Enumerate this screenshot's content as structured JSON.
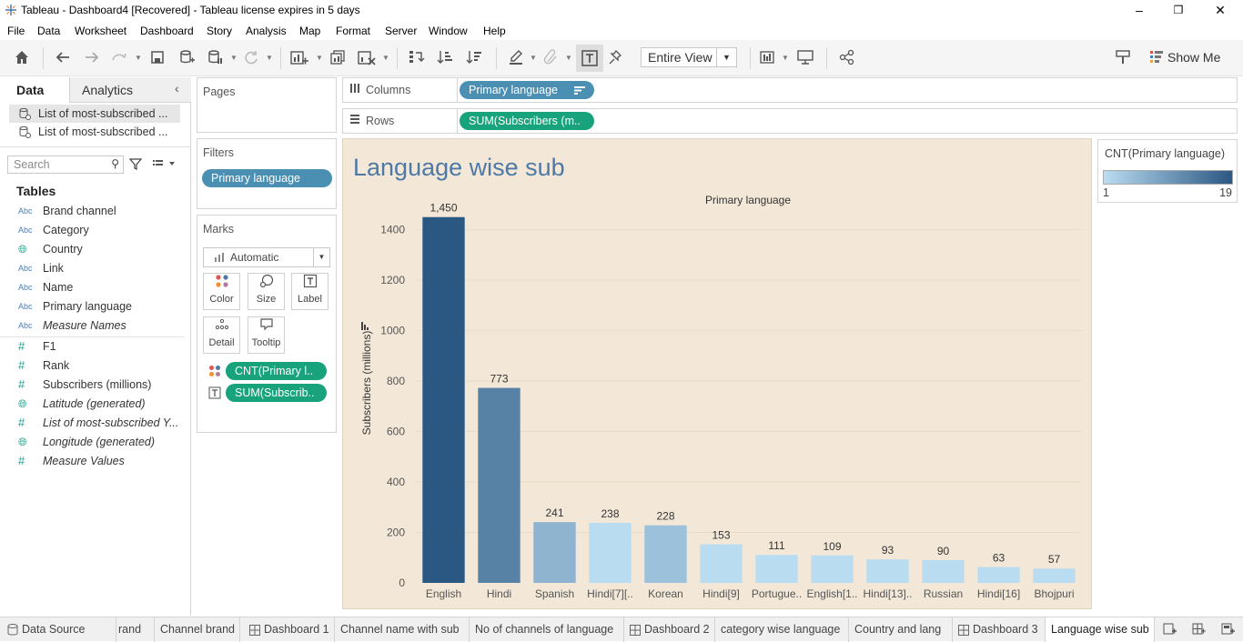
{
  "window": {
    "title": "Tableau - Dashboard4 [Recovered] - Tableau license expires in 5 days"
  },
  "menu": [
    "File",
    "Data",
    "Worksheet",
    "Dashboard",
    "Story",
    "Analysis",
    "Map",
    "Format",
    "Server",
    "Window",
    "Help"
  ],
  "toolbar": {
    "fit": "Entire View",
    "show_me": "Show Me"
  },
  "left_panel": {
    "tab_data": "Data",
    "tab_analytics": "Analytics",
    "datasources": [
      "List of most-subscribed ...",
      "List of most-subscribed ..."
    ],
    "search_placeholder": "Search",
    "tables_heading": "Tables",
    "fields": [
      {
        "type": "Abc",
        "name": "Brand channel"
      },
      {
        "type": "Abc",
        "name": "Category"
      },
      {
        "type": "geo",
        "name": "Country"
      },
      {
        "type": "Abc",
        "name": "Link"
      },
      {
        "type": "Abc",
        "name": "Name"
      },
      {
        "type": "Abc",
        "name": "Primary language"
      },
      {
        "type": "Abc",
        "name": "Measure Names"
      },
      {
        "type": "#",
        "name": "F1"
      },
      {
        "type": "#",
        "name": "Rank"
      },
      {
        "type": "#",
        "name": "Subscribers (millions)"
      },
      {
        "type": "geo",
        "name": "Latitude (generated)"
      },
      {
        "type": "#",
        "name": "List of most-subscribed Y..."
      },
      {
        "type": "geo",
        "name": "Longitude (generated)"
      },
      {
        "type": "#",
        "name": "Measure Values"
      }
    ]
  },
  "cards": {
    "pages": "Pages",
    "filters": "Filters",
    "filter_pill": "Primary language",
    "marks": "Marks",
    "mark_type": "Automatic",
    "mark_buttons": [
      "Color",
      "Size",
      "Label",
      "Detail",
      "Tooltip"
    ],
    "mark_pills": [
      "CNT(Primary l..",
      "SUM(Subscrib.."
    ]
  },
  "shelves": {
    "columns_label": "Columns",
    "columns_pill": "Primary language",
    "rows_label": "Rows",
    "rows_pill": "SUM(Subscribers (m.."
  },
  "legend": {
    "title": "CNT(Primary language)",
    "min": "1",
    "max": "19"
  },
  "viz": {
    "title": "Language wise sub"
  },
  "chart_data": {
    "type": "bar",
    "title": "Language wise sub",
    "xlabel": "Primary language",
    "ylabel": "Subscribers (millions)",
    "categories": [
      "English",
      "Hindi",
      "Spanish",
      "Hindi[7][..",
      "Korean",
      "Hindi[9]",
      "Portugue..",
      "English[1..",
      "Hindi[13]..",
      "Russian",
      "Hindi[16]",
      "Bhojpuri"
    ],
    "values": [
      1450,
      773,
      241,
      238,
      228,
      153,
      111,
      109,
      93,
      90,
      63,
      57
    ],
    "value_labels": [
      "1,450",
      "773",
      "241",
      "238",
      "228",
      "153",
      "111",
      "109",
      "93",
      "90",
      "63",
      "57"
    ],
    "color_values": [
      19,
      10,
      3,
      1,
      2,
      1,
      1,
      1,
      1,
      1,
      1,
      1
    ],
    "yticks": [
      0,
      200,
      400,
      600,
      800,
      1000,
      1200,
      1400
    ],
    "ylim": [
      0,
      1550
    ],
    "grid": true,
    "colors": {
      "low": "#b9dcf0",
      "high": "#2b5783",
      "background": "#f3e8d8"
    }
  },
  "sheet_tabs": [
    "Data Source",
    "rand",
    "Channel brand",
    "Dashboard 1",
    "Channel name with sub",
    "No of channels of language",
    "Dashboard 2",
    "category wise language",
    "Country and lang",
    "Dashboard 3",
    "Language wise sub"
  ]
}
